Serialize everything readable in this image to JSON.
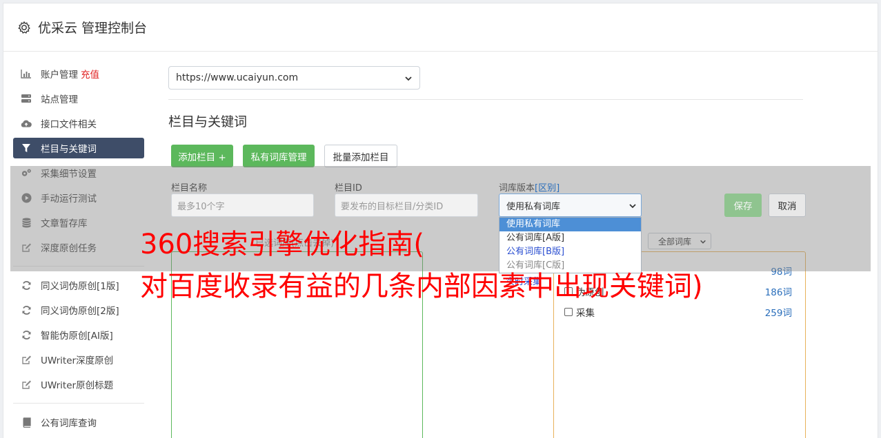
{
  "header": {
    "title": "优采云 管理控制台"
  },
  "sidebar": {
    "items": [
      {
        "label": "账户管理",
        "extra": "充值",
        "icon": "bar-chart-icon"
      },
      {
        "label": "站点管理",
        "icon": "server-icon"
      },
      {
        "label": "接口文件相关",
        "icon": "cloud-upload-icon"
      },
      {
        "label": "栏目与关键词",
        "icon": "filter-icon",
        "active": true
      },
      {
        "label": "采集细节设置",
        "icon": "gears-icon"
      },
      {
        "label": "手动运行测试",
        "icon": "play-circle-icon"
      },
      {
        "label": "文章暂存库",
        "icon": "database-icon"
      },
      {
        "label": "深度原创任务",
        "icon": "edit-icon"
      }
    ],
    "items2": [
      {
        "label": "同义词伪原创[1版]",
        "icon": "refresh-icon"
      },
      {
        "label": "同义词伪原创[2版]",
        "icon": "refresh-icon"
      },
      {
        "label": "智能伪原创[AI版]",
        "icon": "refresh-icon"
      },
      {
        "label": "UWriter深度原创",
        "icon": "edit-icon"
      },
      {
        "label": "UWriter原创标题",
        "icon": "edit-icon"
      }
    ],
    "items3": [
      {
        "label": "公有词库查询",
        "icon": "book-icon"
      }
    ]
  },
  "main": {
    "site_select": "https://www.ucaiyun.com",
    "section_title": "栏目与关键词",
    "buttons": {
      "add_column": "添加栏目 +",
      "private_lib": "私有词库管理",
      "batch_add": "批量添加栏目"
    },
    "form": {
      "name_label": "栏目名称",
      "name_placeholder": "最多10个字",
      "id_label": "栏目ID",
      "id_placeholder": "要发布的目标栏目/分类ID",
      "version_label": "词库版本",
      "version_link": "[区别]",
      "version_selected": "使用私有词库",
      "save": "保存",
      "cancel": "取消"
    },
    "dropdown_options": [
      "使用私有词库",
      "公有词库[A版]",
      "公有词库[B版]",
      "公有词库[C版]"
    ],
    "selected_hint": "已选词库(点击去掉)",
    "lib_filter": "全部词库",
    "libraries": [
      {
        "name": "",
        "count": "98词"
      },
      {
        "name": "伪原创",
        "count": "186词"
      },
      {
        "name": "采集",
        "count": "259词"
      }
    ],
    "obscured_text": "实时采集"
  },
  "overlay_text": {
    "line1": "360搜索引擎优化指南(",
    "line2": "对百度收录有益的几条内部因素中出现关键词)"
  },
  "colors": {
    "active_nav": "#3e4d68",
    "green": "#5cb85c",
    "recharge": "#e02020",
    "ad": "#ff0000"
  }
}
